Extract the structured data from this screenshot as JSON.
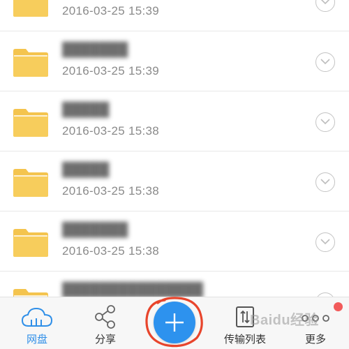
{
  "files": [
    {
      "name": "",
      "date": "2016-03-25 15:39"
    },
    {
      "name": "███████",
      "date": "2016-03-25 15:39"
    },
    {
      "name": "█████",
      "date": "2016-03-25 15:38"
    },
    {
      "name": "█████",
      "date": "2016-03-25 15:38"
    },
    {
      "name": "███████",
      "date": "2016-03-25 15:38"
    },
    {
      "name": "███████████████",
      "date": ""
    }
  ],
  "tabbar": {
    "tabs": [
      {
        "label": "网盘",
        "icon": "cloud-icon",
        "active": true
      },
      {
        "label": "分享",
        "icon": "share-icon",
        "active": false
      },
      {
        "label": "传输列表",
        "icon": "transfer-list-icon",
        "active": false
      },
      {
        "label": "更多",
        "icon": "more-dots-icon",
        "active": false
      }
    ],
    "add_icon": "plus-icon"
  },
  "watermark": "Baidu经验",
  "colors": {
    "accent": "#2d92ee",
    "folder": "#f4c44e",
    "badge": "#f25b5b",
    "annotation": "#e8452c"
  }
}
